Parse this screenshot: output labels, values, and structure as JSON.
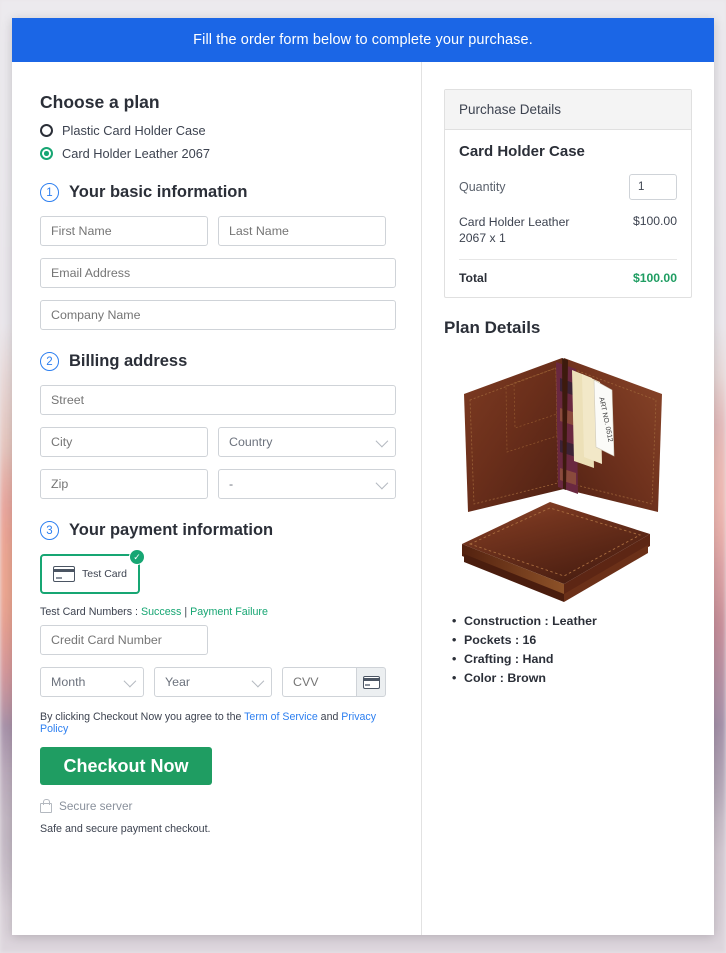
{
  "banner": {
    "text": "Fill the order form below to complete your purchase."
  },
  "plan": {
    "heading": "Choose a plan",
    "options": [
      {
        "label": "Plastic Card Holder Case",
        "selected": false
      },
      {
        "label": "Card Holder Leather 2067",
        "selected": true
      }
    ]
  },
  "steps": {
    "basic": {
      "num": "1",
      "title": "Your basic information"
    },
    "billing": {
      "num": "2",
      "title": "Billing address"
    },
    "payment": {
      "num": "3",
      "title": "Your payment information"
    }
  },
  "fields": {
    "first_name": "First Name",
    "last_name": "Last Name",
    "email": "Email Address",
    "company": "Company Name",
    "street": "Street",
    "city": "City",
    "country": "Country",
    "zip": "Zip",
    "state": "-",
    "credit_card": "Credit Card Number",
    "month": "Month",
    "year": "Year",
    "cvv": "CVV"
  },
  "payment": {
    "tile_label": "Test  Card",
    "tile_icon": "credit-card-icon",
    "tile_badge_icon": "check-circle-icon",
    "test_numbers_label": "Test Card Numbers : ",
    "success_link": "Success",
    "separator": " | ",
    "failure_link": "Payment Failure",
    "terms_prefix": "By clicking Checkout Now you agree to the ",
    "terms_link": "Term of Service",
    "terms_and": " and ",
    "privacy_link": "Privacy Policy",
    "checkout_label": "Checkout Now",
    "secure_label": "Secure server",
    "secure_icon": "lock-icon",
    "safe_note": "Safe and secure payment checkout."
  },
  "purchase": {
    "header": "Purchase Details",
    "product_title": "Card Holder Case",
    "quantity_label": "Quantity",
    "quantity_value": "1",
    "line_item_name": "Card Holder Leather 2067 x 1",
    "line_item_price": "$100.00",
    "total_label": "Total",
    "total_value": "$100.00"
  },
  "plan_details": {
    "heading": "Plan Details",
    "image_alt": "brown-leather-card-holder-wallet",
    "specs": [
      "Construction : Leather",
      "Pockets : 16",
      "Crafting : Hand",
      "Color : Brown"
    ]
  },
  "colors": {
    "banner_blue": "#1b66e6",
    "accent_green": "#17a673",
    "checkout_green": "#1f9d62",
    "step_blue": "#2d7ff0",
    "link_blue": "#2d7ff0"
  }
}
